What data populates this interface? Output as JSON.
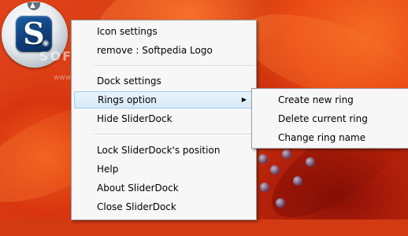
{
  "dock": {
    "icon_letter": "S",
    "icon_name": "softpedia-logo-icon",
    "ring_arrow": "▲"
  },
  "watermark": {
    "text": "SOFTPEDIA",
    "url": "www.softpedia.com"
  },
  "context_menu": {
    "items": [
      {
        "label": "Icon settings"
      },
      {
        "label": "remove : Softpedia Logo"
      },
      {
        "label": "Dock settings"
      },
      {
        "label": "Rings option",
        "has_submenu": true,
        "submenu_arrow": "▶"
      },
      {
        "label": "Hide SliderDock"
      },
      {
        "label": "Lock SliderDock's position"
      },
      {
        "label": "Help"
      },
      {
        "label": "About SliderDock"
      },
      {
        "label": "Close SliderDock"
      }
    ]
  },
  "rings_submenu": {
    "items": [
      {
        "label": "Create new ring"
      },
      {
        "label": "Delete current ring"
      },
      {
        "label": "Change ring name"
      }
    ]
  },
  "colors": {
    "highlight": "#d7eaf8",
    "menu_background": "#f7f7f7",
    "wallpaper": "#d23a12"
  }
}
